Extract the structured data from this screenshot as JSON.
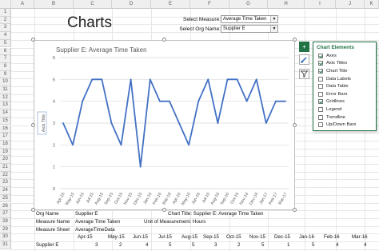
{
  "columns": [
    "A",
    "B",
    "C",
    "D",
    "E",
    "F",
    "G",
    "H",
    "I",
    "J",
    "K",
    "L",
    "M",
    "N",
    "O"
  ],
  "rows": [
    "1",
    "2",
    "3",
    "4",
    "5",
    "6",
    "7",
    "8",
    "9",
    "10",
    "11",
    "12",
    "13",
    "14",
    "15",
    "16",
    "17",
    "18",
    "19",
    "20",
    "21",
    "22",
    "23",
    "24",
    "25",
    "26",
    "27",
    "28",
    "29",
    "30",
    "31"
  ],
  "sheet_title": "Charts",
  "controls": {
    "measure_label": "Select Measure:",
    "measure_value": "Average Time Taken",
    "org_label": "Select Org Name:",
    "org_value": "Supplier E"
  },
  "chart_data": {
    "type": "line",
    "title": "Supplier E: Average Time Taken",
    "ylabel": "Axis Title",
    "xlabel": "",
    "ylim": [
      0,
      6
    ],
    "y_ticks": [
      "0",
      "1",
      "2",
      "3",
      "4",
      "5",
      "6"
    ],
    "grid": true,
    "categories": [
      "Apr-15",
      "May-15",
      "Jun-15",
      "Jul-15",
      "Aug-15",
      "Sep-15",
      "Oct-15",
      "Nov-15",
      "Dec-15",
      "Jan-16",
      "Feb-16",
      "Mar-16",
      "Apr-16",
      "May-16",
      "Jun-16",
      "Jul-16",
      "Aug-16",
      "Sep-16",
      "Oct-16",
      "Nov-16",
      "Dec-16",
      "Jan-17",
      "Feb-17",
      "Mar-17"
    ],
    "series": [
      {
        "values": [
          3,
          2,
          4,
          5,
          5,
          3,
          2,
          5,
          1,
          5,
          4,
          4,
          3,
          2,
          4,
          5,
          3,
          5,
          5,
          4,
          5,
          3,
          4,
          4
        ],
        "color": "#4472c4"
      }
    ]
  },
  "chart_elements": {
    "title": "Chart Elements",
    "items": [
      {
        "label": "Axes",
        "checked": true
      },
      {
        "label": "Axis Titles",
        "checked": true
      },
      {
        "label": "Chart Title",
        "checked": true
      },
      {
        "label": "Data Labels",
        "checked": false
      },
      {
        "label": "Data Table",
        "checked": false
      },
      {
        "label": "Error Bars",
        "checked": false
      },
      {
        "label": "Gridlines",
        "checked": true
      },
      {
        "label": "Legend",
        "checked": false
      },
      {
        "label": "Trendline",
        "checked": false
      },
      {
        "label": "Up/Down Bars",
        "checked": false
      }
    ]
  },
  "side_buttons": {
    "add": "+",
    "style": "brush-icon",
    "filter": "filter-icon"
  },
  "cells": {
    "org_name_label": "Org Name",
    "org_name_value": "Supplier E",
    "chart_title_text": "Chart Title: Supplier E: Average Time Taken",
    "measure_name_label": "Measure Name",
    "measure_name_value": "Average Time Taken",
    "unit_text": "Unit of Measurement: Hours",
    "measure_sheet_label": "Measure Sheet",
    "measure_sheet_value": "AverageTimeData",
    "months_header": [
      "Apr-15",
      "May-15",
      "Jun-15",
      "Jul-15",
      "Aug-15",
      "Sep-15",
      "Oct-15",
      "Nov-15",
      "Dec-15",
      "Jan-16",
      "Feb-16",
      "Mar-16"
    ],
    "row31_label": "Supplier E",
    "row31_values": [
      "3",
      "2",
      "4",
      "5",
      "5",
      "3",
      "2",
      "5",
      "1",
      "5",
      "4",
      "4"
    ]
  }
}
